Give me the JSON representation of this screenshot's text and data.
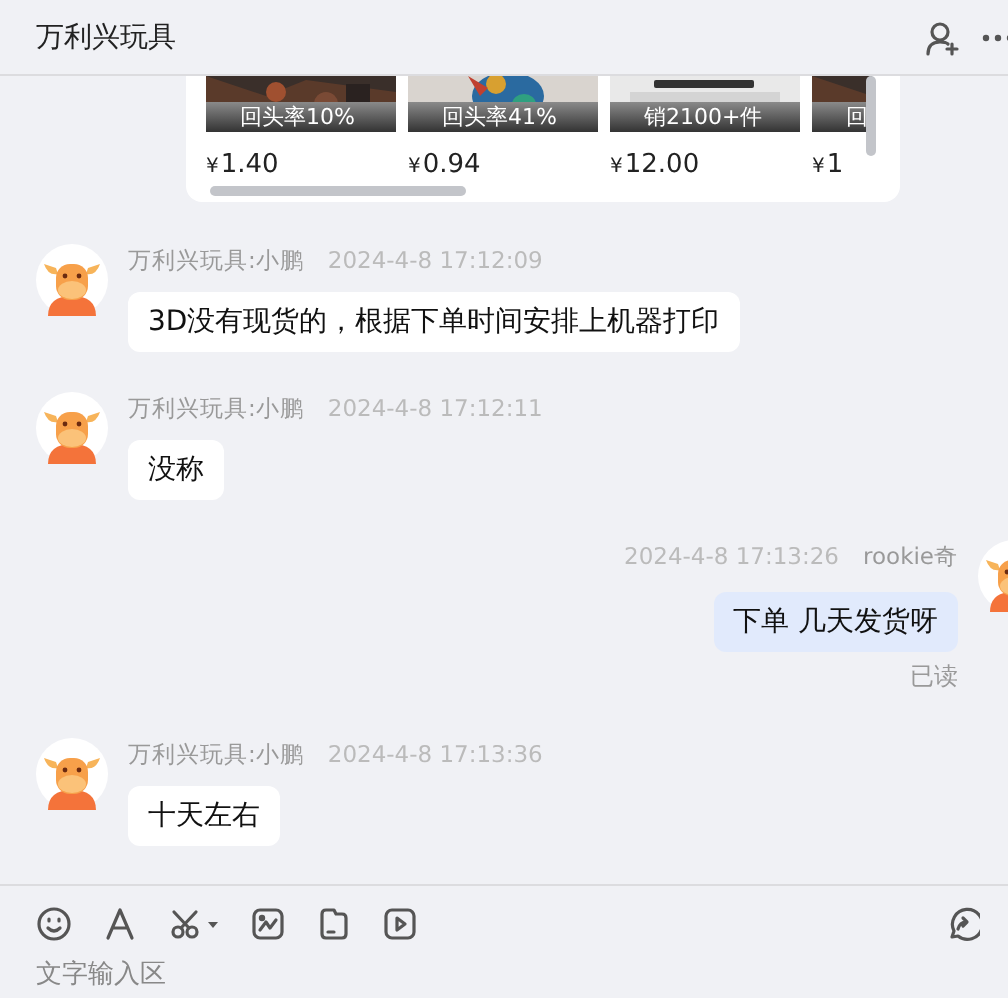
{
  "header": {
    "title": "万利兴玩具"
  },
  "product_card": {
    "products": [
      {
        "caption": "回头率10%",
        "currency": "¥",
        "amount": "1.40"
      },
      {
        "caption": "回头率41%",
        "currency": "¥",
        "amount": "0.94"
      },
      {
        "caption": "销2100+件",
        "currency": "¥",
        "amount": "12.00"
      },
      {
        "caption": "回",
        "currency": "¥",
        "amount": "1"
      }
    ]
  },
  "messages": [
    {
      "kind": "incoming",
      "sender": "万利兴玩具:小鹏",
      "time": "2024-4-8 17:12:09",
      "text": "3D没有现货的，根据下单时间安排上机器打印"
    },
    {
      "kind": "incoming",
      "sender": "万利兴玩具:小鹏",
      "time": "2024-4-8 17:12:11",
      "text": "没称"
    },
    {
      "kind": "outgoing",
      "sender": "rookie奇",
      "time": "2024-4-8 17:13:26",
      "text": "下单 几天发货呀",
      "status": "已读"
    },
    {
      "kind": "incoming",
      "sender": "万利兴玩具:小鹏",
      "time": "2024-4-8 17:13:36",
      "text": "十天左右"
    }
  ],
  "composer": {
    "placeholder": "文字输入区"
  }
}
